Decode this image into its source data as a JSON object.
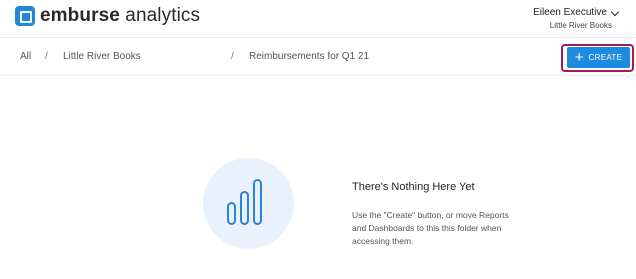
{
  "brand": {
    "name_bold": "emburse",
    "name_rest": " analytics"
  },
  "user": {
    "name": "Eileen Executive",
    "org": "Little River Books"
  },
  "breadcrumb": [
    {
      "label": "All"
    },
    {
      "label": "Little River Books"
    },
    {
      "label": "Reimbursements for Q1 21"
    }
  ],
  "breadcrumb_separator": "/",
  "actions": {
    "create_label": "CREATE",
    "create_icon": "plus-icon",
    "create_plus_glyph": "+"
  },
  "empty_state": {
    "icon": "bar-chart-icon",
    "title": "There's Nothing Here Yet",
    "description": "Use the \"Create\" button, or move Reports and Dashboards to this this folder when accessing them."
  },
  "colors": {
    "accent": "#1d8ce0",
    "highlight_outline": "#a21b5c",
    "icon_bg": "#e9f2fc"
  }
}
